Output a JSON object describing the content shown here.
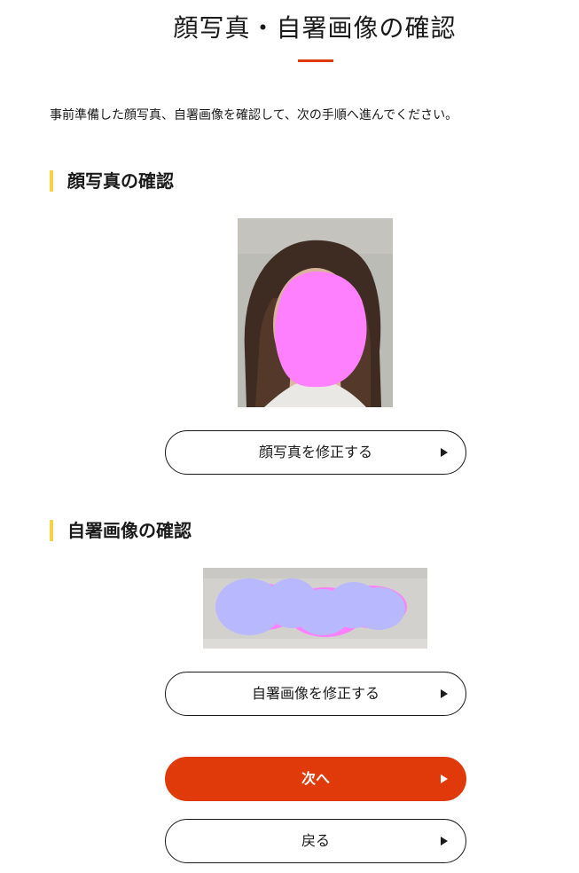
{
  "page": {
    "title": "顔写真・自署画像の確認",
    "intro": "事前準備した顔写真、自署画像を確認して、次の手順へ進んでください。"
  },
  "face_section": {
    "heading": "顔写真の確認",
    "edit_button": "顔写真を修正する",
    "button_icon": "triangle-right"
  },
  "signature_section": {
    "heading": "自署画像の確認",
    "edit_button": "自署画像を修正する",
    "button_icon": "triangle-right"
  },
  "actions": {
    "next_button": "次へ",
    "back_button": "戻る"
  },
  "colors": {
    "accent": "#e03a0a",
    "heading_bar": "#f5d24b",
    "text": "#1a1a1a",
    "face_redaction": "#ff80ff",
    "signature_redaction": "#b8b8ff"
  }
}
